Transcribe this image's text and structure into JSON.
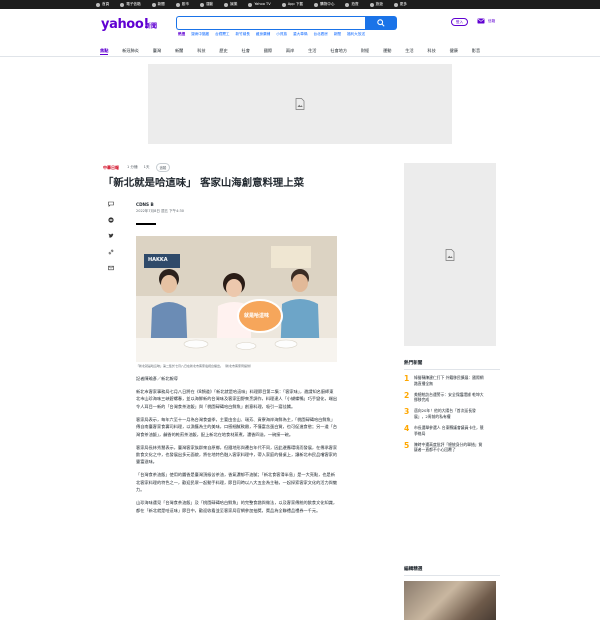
{
  "topbar": {
    "items": [
      "首頁",
      "電子信箱",
      "新聞",
      "股市",
      "運動",
      "娛樂",
      "Yahoo TV",
      "App 下載",
      "購物中心",
      "拍賣",
      "旅遊",
      "更多"
    ]
  },
  "header": {
    "logo": "yahoo!",
    "logo_sub": "新聞",
    "search_placeholder": "",
    "trending_label": "熱搜",
    "trending": [
      "疑病中猶搬",
      "台鐵罷工",
      "新竹總長",
      "藏身藥鋪",
      "小資族",
      "重大車禍",
      "台北看房",
      "新聞",
      "福利大放送"
    ],
    "login": "登入",
    "mail": "信箱"
  },
  "nav": {
    "items": [
      "焦點",
      "新冠肺炎",
      "臺灣",
      "新聞",
      "科技",
      "歷史",
      "社會",
      "國際",
      "兩岸",
      "生活",
      "社會地方",
      "財經",
      "運動",
      "生活",
      "科技",
      "健康",
      "影音"
    ],
    "active_index": 0
  },
  "article": {
    "source": "中華日報",
    "meta_time": "1天",
    "meta_read": "1 分鐘",
    "follow": "追蹤",
    "title": "「新北就是哈這味」 客家山海創意料理上菜",
    "author": "CDNS B",
    "date": "2022年7月8日 週五 下午4:30",
    "photo_sign": "HAKKA",
    "photo_board": "就是哈這味",
    "photo_caption": "「新北就是哈這味」第二集於七月八日在新北市客家電視台播出。（新北市客家局提供）",
    "paragraphs": [
      "記者陳瑜彥／新北報導",
      "新北市客家事務局七月八日將在《8頻道》「新北就是哈這味」料理節目第二集：「客家味」，邀請知名廚師東北市山珍海味三峽碧螺春，並以海鮮新的台灣味及客家田野來烹調作，料理達人「小蝴蝶鴨」巧手變化，端出令人耳目一新的「台灣食茶油飯」與「桃園碌碡哈白鮮魚」創意料理，吸引一窩佳餚。",
      "客家局表示，每年六至十一月為台灣食盛季，主要由金山、瑞芳、貢寮海岸海鮮為主，「桃園碌碡哈白鮮魚」傳自南臺客家食壽司料理，以漁獲為主的美味，口感細膩軟嫩，不僅富含蛋白質，也可促進食慾；另一道「台灣食茶油飯」，鹹香的乾煎茶油飯，配上新北在地食材蒸煮，濃香四溢，一碗接一碗。",
      "客家局長林秀慧表示，臺灣客家族群來自原鄉，但隨地形與遷台年代不同，因此邊應環境而發展，在傳承客家飲食文化之中，也發展出多元面貌，將在地特色融入客家料理中，帶入家庭的餐桌上，讓新北市民品嚐客家的豐富滋味。",
      "「台灣食茶油飯」使用的醬香是臺灣頂級苦茶油，香氣濃郁不油膩；「新北食客滑半島」是一大亮點，也是新北客家料理的特色之一，歡迎民眾一起動手料理，節目同時以八大五金為主軸，一起探索客家文化的活力與魅力。",
      "山珍海味遇見「台灣食茶油飯」及「桃園碌碡哈白鮮魚」的完整食譜與做法，以及客家傳統的飲食文化知識，都在「新北就是哈這味」節目中，歡迎收看並至客家局官網參加抽獎，獎品為全聯禮品禮券一千元。"
    ]
  },
  "sidebar": {
    "hot_title": "熱門新聞",
    "hot_news": [
      {
        "num": "1",
        "text": "綠營稱陳建仁打下 外籍移民擴展：國際網路直播全無"
      },
      {
        "num": "2",
        "text": "美總統訪台遇警示：安全保護證據 乾坤大挪移完成"
      },
      {
        "num": "3",
        "text": "邁向20年！他的大陽台「首次延長發展」，2周前的私有權"
      },
      {
        "num": "4",
        "text": "市長選舉參選人 台東縣議會議員卡住，競爭格局"
      },
      {
        "num": "5",
        "text": "陳時中遭高度批評「總統身分的舉措」質疑者一直都不小心回覆了"
      }
    ],
    "picks_title": "編輯精選"
  },
  "colors": {
    "brand": "#6001d2",
    "search_blue": "#1a73e8",
    "hot_number": "#ffa700",
    "source_red": "#d0021b"
  }
}
